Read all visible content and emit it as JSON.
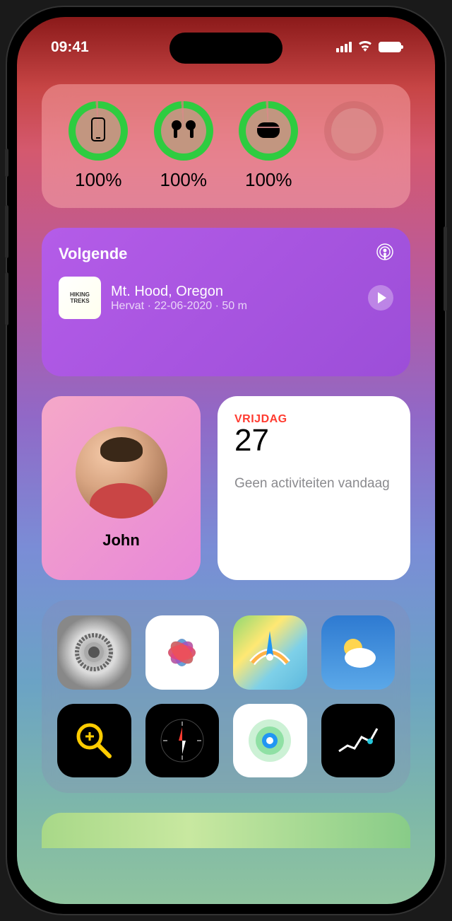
{
  "status": {
    "time": "09:41"
  },
  "batteries": {
    "items": [
      {
        "icon": "phone",
        "percent": "100%"
      },
      {
        "icon": "airpods",
        "percent": "100%"
      },
      {
        "icon": "case",
        "percent": "100%"
      },
      {
        "icon": "empty",
        "percent": ""
      }
    ]
  },
  "podcast": {
    "header": "Volgende",
    "art_label": "HIKING TREKS",
    "episode_title": "Mt. Hood, Oregon",
    "meta": "Hervat · 22-06-2020 · 50 m"
  },
  "contact": {
    "name": "John"
  },
  "calendar": {
    "day": "VRIJDAG",
    "date": "27",
    "events": "Geen activiteiten vandaag"
  },
  "apps": [
    "settings",
    "photos",
    "maps",
    "weather",
    "magnifier",
    "compass",
    "findmy",
    "stocks"
  ]
}
